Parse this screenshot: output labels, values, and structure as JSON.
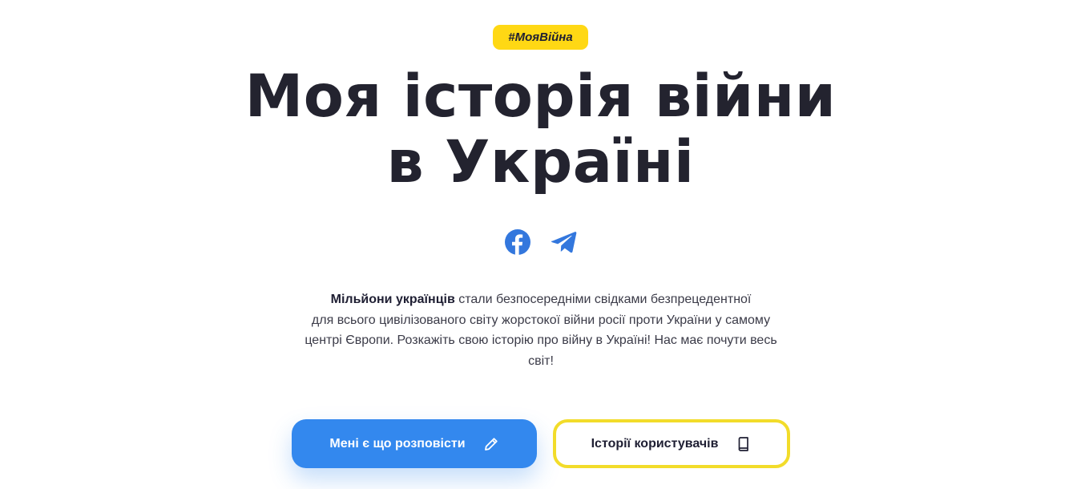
{
  "hero": {
    "tag": "#МояВійна",
    "title_line1": "Моя історія війни",
    "title_line2": "в Україні"
  },
  "socials": [
    {
      "icon": "facebook-icon",
      "color": "#3377dd"
    },
    {
      "icon": "telegram-icon",
      "color": "#3377dd"
    }
  ],
  "description": {
    "bold_lead": "Мільйони українців",
    "line1_rest": " стали безпосередніми свідками безпрецедентної",
    "line2": "для всього цивілізованого світу жорстокої війни росії проти України у самому",
    "line3": "центрі Європи. Розкажіть свою історію про війну в Україні! Нас має почути весь",
    "line4": "світ!"
  },
  "actions": {
    "primary_label": "Мені є що розповісти",
    "primary_icon": "pencil-icon",
    "secondary_label": "Історії користувачів",
    "secondary_icon": "book-icon"
  },
  "colors": {
    "accent_blue": "#3388ee",
    "accent_yellow": "#ffd814",
    "title": "#23232f"
  }
}
